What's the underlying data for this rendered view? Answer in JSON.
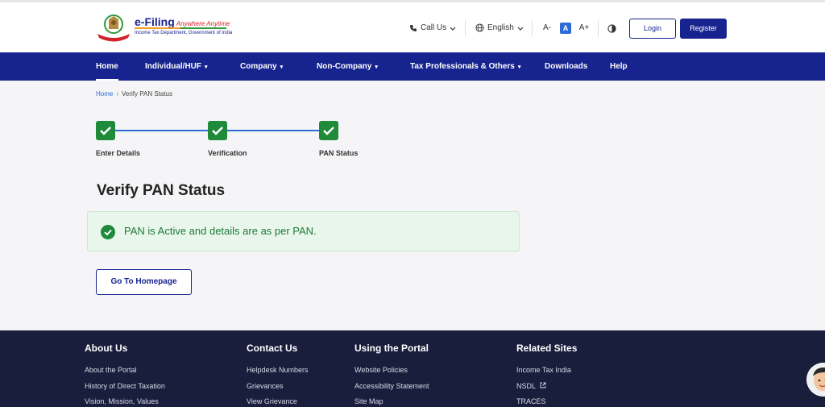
{
  "header": {
    "logo_title": "e-Filing",
    "logo_tagline": "Anywhere Anytime",
    "logo_subtitle": "Income Tax Department, Government of India",
    "call_us": "Call Us",
    "language": "English",
    "font_decrease": "A-",
    "font_normal": "A",
    "font_increase": "A+",
    "login_label": "Login",
    "register_label": "Register"
  },
  "nav": {
    "items": [
      {
        "label": "Home"
      },
      {
        "label": "Individual/HUF"
      },
      {
        "label": "Company"
      },
      {
        "label": "Non-Company"
      },
      {
        "label": "Tax Professionals & Others"
      },
      {
        "label": "Downloads"
      },
      {
        "label": "Help"
      }
    ]
  },
  "breadcrumb": {
    "home": "Home",
    "separator": "›",
    "current": "Verify PAN Status"
  },
  "stepper": {
    "steps": [
      {
        "label": "Enter Details"
      },
      {
        "label": "Verification"
      },
      {
        "label": "PAN Status"
      }
    ]
  },
  "main": {
    "title": "Verify PAN Status",
    "alert_message": "PAN is Active and details are as per PAN.",
    "go_home_label": "Go To Homepage"
  },
  "footer": {
    "columns": [
      {
        "heading": "About Us",
        "links": [
          "About the Portal",
          "History of Direct Taxation",
          "Vision, Mission, Values"
        ]
      },
      {
        "heading": "Contact Us",
        "links": [
          "Helpdesk Numbers",
          "Grievances",
          "View Grievance"
        ]
      },
      {
        "heading": "Using the Portal",
        "links": [
          "Website Policies",
          "Accessibility Statement",
          "Site Map"
        ]
      },
      {
        "heading": "Related Sites",
        "links": [
          "Income Tax India",
          "NSDL",
          "TRACES"
        ]
      }
    ]
  },
  "colors": {
    "primary": "#17238f",
    "success": "#1f8a3a",
    "footer_bg": "#191e3c"
  }
}
